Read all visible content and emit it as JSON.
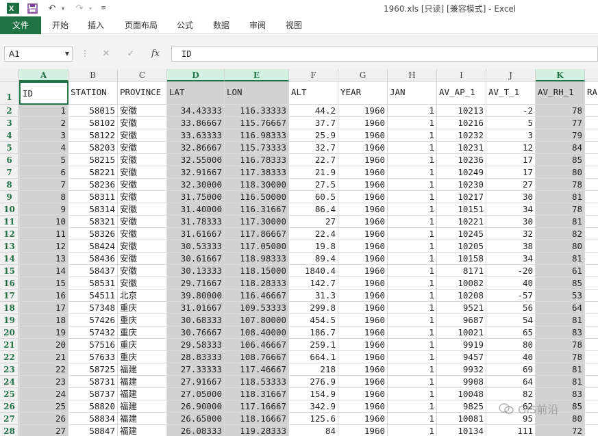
{
  "titlebar": {
    "title": "1960.xls  [只读]  [兼容模式] - Excel"
  },
  "ribbon": {
    "tabs": [
      "文件",
      "开始",
      "插入",
      "页面布局",
      "公式",
      "数据",
      "审阅",
      "视图"
    ]
  },
  "formula_bar": {
    "name_box": "A1",
    "fx_label": "fx",
    "formula": "ID"
  },
  "watermark": {
    "text": "GIS前沿"
  },
  "colors": {
    "accent": "#217346",
    "selected_fill": "#d2d2d2",
    "header_selected": "#d3f0e0"
  },
  "grid": {
    "columns": [
      "A",
      "B",
      "C",
      "D",
      "E",
      "F",
      "G",
      "H",
      "I",
      "J",
      "K"
    ],
    "selected_columns": [
      "A",
      "D",
      "E",
      "K"
    ],
    "header_row": [
      "ID",
      "STATION",
      "PROVINCE",
      "LAT",
      "LON",
      "ALT",
      "YEAR",
      "JAN",
      "AV_AP_1",
      "AV_T_1",
      "AV_RH_1",
      "RA"
    ],
    "rows": [
      [
        "1",
        "58015",
        "安徽",
        "34.43333",
        "116.33333",
        "44.2",
        "1960",
        "1",
        "10213",
        "-2",
        "78"
      ],
      [
        "2",
        "58102",
        "安徽",
        "33.86667",
        "115.76667",
        "37.7",
        "1960",
        "1",
        "10216",
        "5",
        "77"
      ],
      [
        "3",
        "58122",
        "安徽",
        "33.63333",
        "116.98333",
        "25.9",
        "1960",
        "1",
        "10232",
        "3",
        "79"
      ],
      [
        "4",
        "58203",
        "安徽",
        "32.86667",
        "115.73333",
        "32.7",
        "1960",
        "1",
        "10231",
        "12",
        "84"
      ],
      [
        "5",
        "58215",
        "安徽",
        "32.55000",
        "116.78333",
        "22.7",
        "1960",
        "1",
        "10236",
        "17",
        "85"
      ],
      [
        "6",
        "58221",
        "安徽",
        "32.91667",
        "117.38333",
        "21.9",
        "1960",
        "1",
        "10249",
        "17",
        "80"
      ],
      [
        "7",
        "58236",
        "安徽",
        "32.30000",
        "118.30000",
        "27.5",
        "1960",
        "1",
        "10230",
        "27",
        "78"
      ],
      [
        "8",
        "58311",
        "安徽",
        "31.75000",
        "116.50000",
        "60.5",
        "1960",
        "1",
        "10217",
        "30",
        "81"
      ],
      [
        "9",
        "58314",
        "安徽",
        "31.40000",
        "116.31667",
        "86.4",
        "1960",
        "1",
        "10151",
        "34",
        "78"
      ],
      [
        "10",
        "58321",
        "安徽",
        "31.78333",
        "117.30000",
        "27",
        "1960",
        "1",
        "10221",
        "30",
        "81"
      ],
      [
        "11",
        "58326",
        "安徽",
        "31.61667",
        "117.86667",
        "22.4",
        "1960",
        "1",
        "10245",
        "32",
        "82"
      ],
      [
        "12",
        "58424",
        "安徽",
        "30.53333",
        "117.05000",
        "19.8",
        "1960",
        "1",
        "10205",
        "38",
        "80"
      ],
      [
        "13",
        "58436",
        "安徽",
        "30.61667",
        "118.98333",
        "89.4",
        "1960",
        "1",
        "10158",
        "34",
        "81"
      ],
      [
        "14",
        "58437",
        "安徽",
        "30.13333",
        "118.15000",
        "1840.4",
        "1960",
        "1",
        "8171",
        "-20",
        "61"
      ],
      [
        "15",
        "58531",
        "安徽",
        "29.71667",
        "118.28333",
        "142.7",
        "1960",
        "1",
        "10082",
        "40",
        "85"
      ],
      [
        "16",
        "54511",
        "北京",
        "39.80000",
        "116.46667",
        "31.3",
        "1960",
        "1",
        "10208",
        "-57",
        "53"
      ],
      [
        "17",
        "57348",
        "重庆",
        "31.01667",
        "109.53333",
        "299.8",
        "1960",
        "1",
        "9521",
        "56",
        "64"
      ],
      [
        "18",
        "57426",
        "重庆",
        "30.68333",
        "107.80000",
        "454.5",
        "1960",
        "1",
        "9687",
        "54",
        "81"
      ],
      [
        "19",
        "57432",
        "重庆",
        "30.76667",
        "108.40000",
        "186.7",
        "1960",
        "1",
        "10021",
        "65",
        "83"
      ],
      [
        "20",
        "57516",
        "重庆",
        "29.58333",
        "106.46667",
        "259.1",
        "1960",
        "1",
        "9919",
        "80",
        "78"
      ],
      [
        "21",
        "57633",
        "重庆",
        "28.83333",
        "108.76667",
        "664.1",
        "1960",
        "1",
        "9457",
        "40",
        "78"
      ],
      [
        "22",
        "58725",
        "福建",
        "27.33333",
        "117.46667",
        "218",
        "1960",
        "1",
        "9932",
        "69",
        "81"
      ],
      [
        "23",
        "58731",
        "福建",
        "27.91667",
        "118.53333",
        "276.9",
        "1960",
        "1",
        "9908",
        "64",
        "81"
      ],
      [
        "24",
        "58737",
        "福建",
        "27.05000",
        "118.31667",
        "154.9",
        "1960",
        "1",
        "10048",
        "82",
        "83"
      ],
      [
        "25",
        "58820",
        "福建",
        "26.90000",
        "117.16667",
        "342.9",
        "1960",
        "1",
        "9825",
        "62",
        "85"
      ],
      [
        "26",
        "58834",
        "福建",
        "26.65000",
        "118.16667",
        "125.6",
        "1960",
        "1",
        "10081",
        "95",
        "80"
      ],
      [
        "27",
        "58847",
        "福建",
        "26.08333",
        "119.28333",
        "84",
        "1960",
        "1",
        "10134",
        "111",
        "72"
      ]
    ]
  }
}
